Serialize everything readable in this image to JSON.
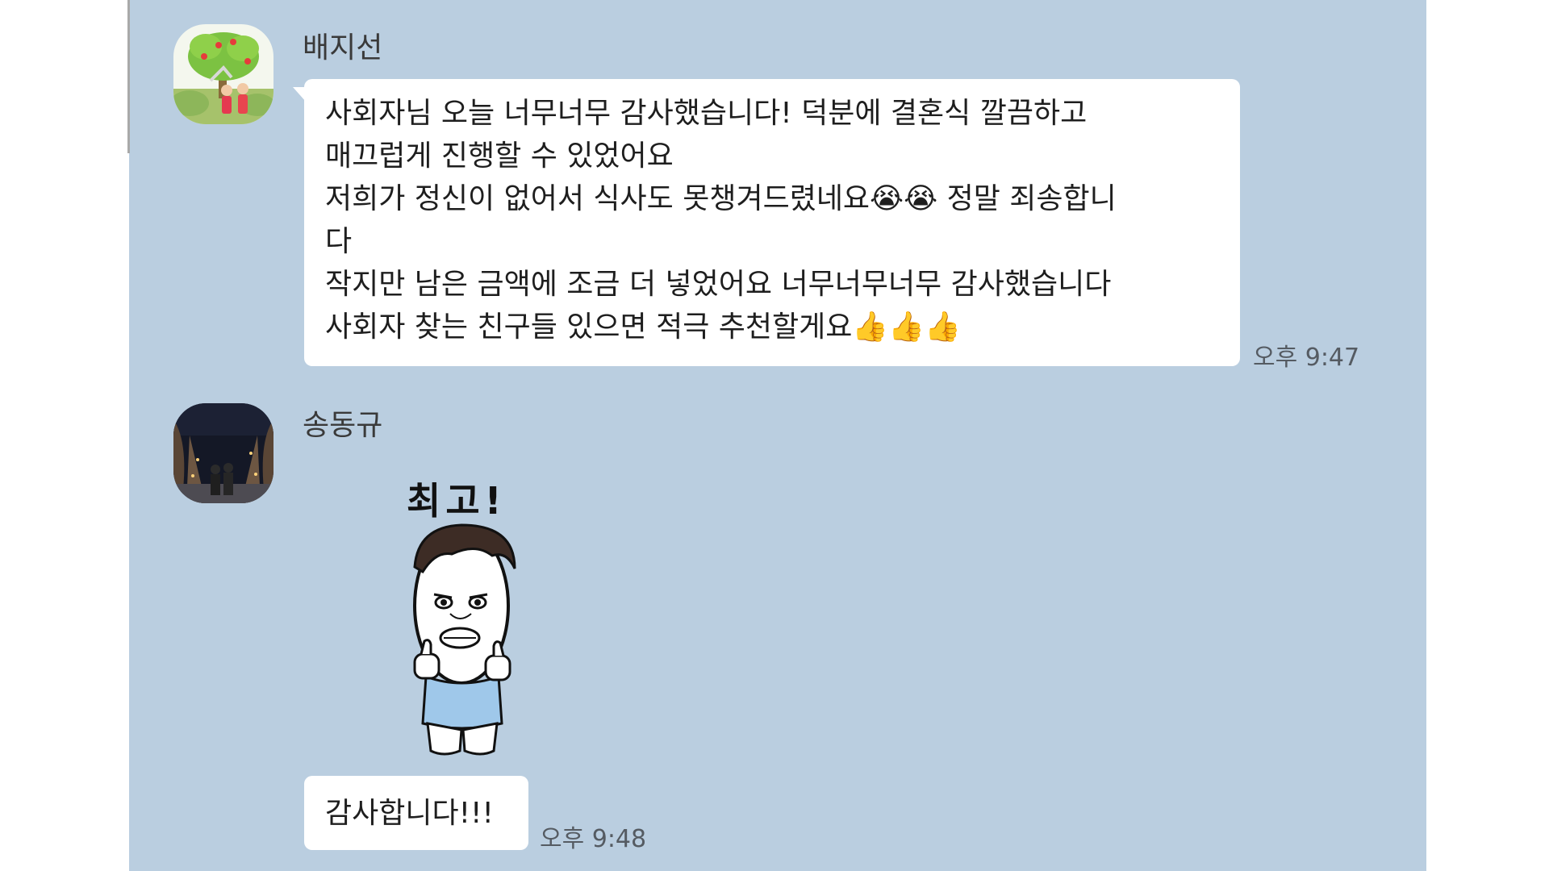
{
  "messages": [
    {
      "sender": "배지선",
      "avatar_icon": "apple-tree-couple-avatar",
      "lines": [
        "사회자님 오늘 너무너무 감사했습니다! 덕분에 결혼식 깔끔하고",
        "매끄럽게 진행할 수 있었어요",
        "저희가 정신이 없어서 식사도 못챙겨드렸네요😭😭 정말 죄송합니",
        "다",
        "작지만 남은 금액에 조금 더 넣었어요 너무너무너무 감사했습니다",
        "사회자 찾는 친구들 있으면 적극 추천할게요👍👍👍"
      ],
      "time": "오후 9:47"
    },
    {
      "sender": "송동규",
      "avatar_icon": "night-photo-avatar",
      "sticker_text": "최고!",
      "sticker_icon": "thumbs-up-character-sticker",
      "lines": [
        "감사합니다!!!"
      ],
      "time": "오후 9:48"
    }
  ],
  "colors": {
    "chat_background": "#bacee0",
    "bubble": "#ffffff",
    "sticker_shirt": "#9fc8ea"
  }
}
